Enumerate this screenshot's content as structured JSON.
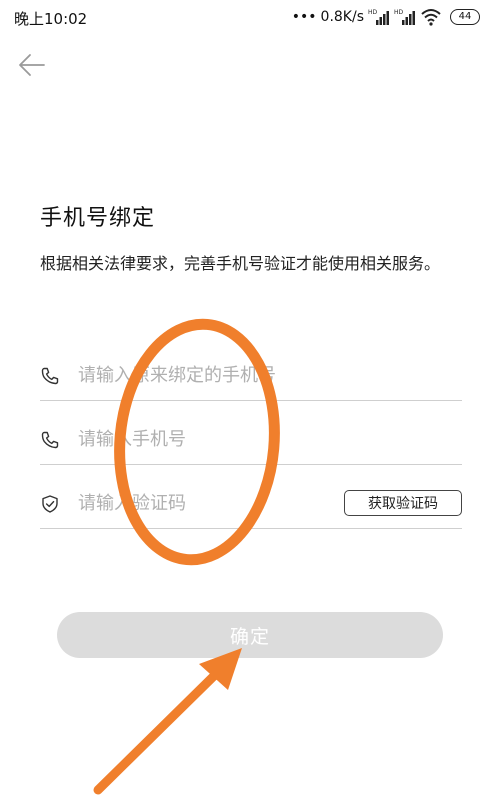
{
  "status_bar": {
    "time": "晚上10:02",
    "network_speed": "0.8K/s",
    "battery_level": "44",
    "icons": [
      "signal-hd-icon",
      "signal-hd-icon",
      "wifi-icon",
      "battery-icon"
    ]
  },
  "nav": {
    "back_icon": "arrow-left-icon"
  },
  "header": {
    "title": "手机号绑定",
    "description": "根据相关法律要求，完善手机号验证才能使用相关服务。"
  },
  "form": {
    "original_phone": {
      "placeholder": "请输入原来绑定的手机号",
      "value": "",
      "icon": "phone-icon"
    },
    "new_phone": {
      "placeholder": "请输入手机号",
      "value": "",
      "icon": "phone-icon"
    },
    "verification_code": {
      "placeholder": "请输入验证码",
      "value": "",
      "icon": "shield-check-icon"
    },
    "get_code_label": "获取验证码"
  },
  "actions": {
    "confirm_label": "确定",
    "confirm_color": "#dcdcdc"
  },
  "annotation": {
    "color": "#f07f2c"
  }
}
